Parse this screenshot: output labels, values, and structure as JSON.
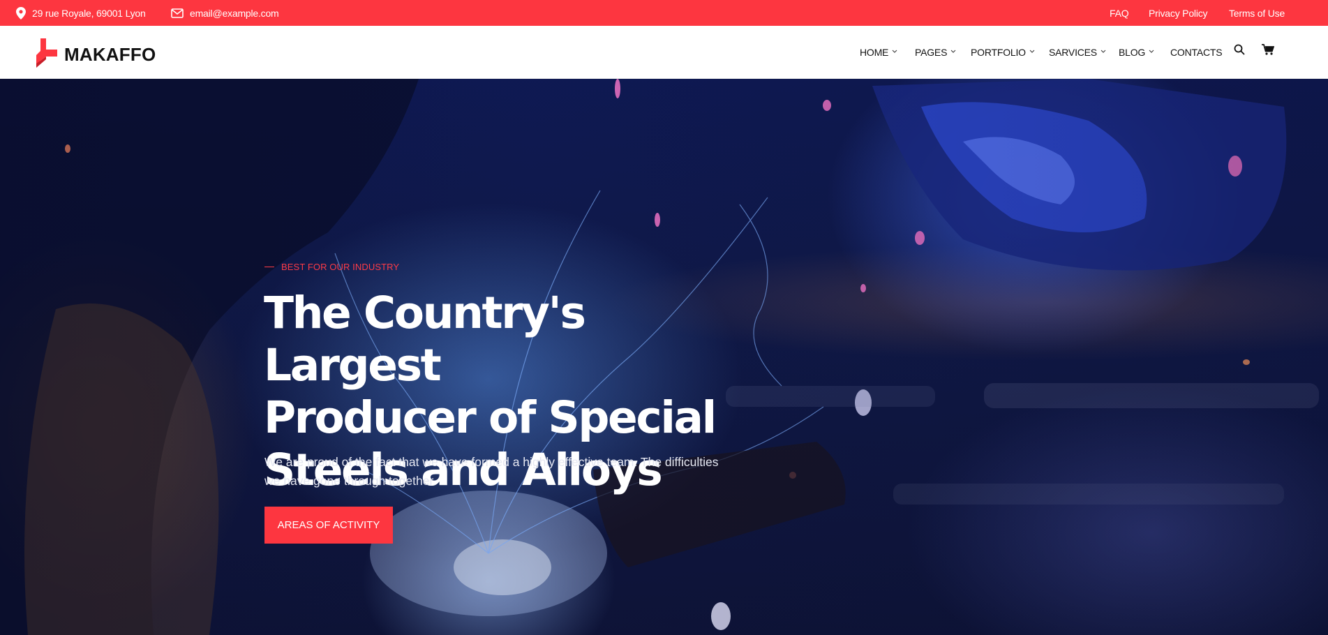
{
  "topbar": {
    "address": "29 rue Royale, 69001 Lyon",
    "email": "email@example.com",
    "links": [
      "FAQ",
      "Privacy Policy",
      "Terms of Use"
    ]
  },
  "brand": {
    "name": "MAKAFFO",
    "accent": "#fd3640"
  },
  "nav": {
    "items": [
      {
        "label": "HOME",
        "has_dropdown": true
      },
      {
        "label": "PAGES",
        "has_dropdown": true
      },
      {
        "label": "PORTFOLIO",
        "has_dropdown": true
      },
      {
        "label": "SARVICES",
        "has_dropdown": true
      },
      {
        "label": "BLOG",
        "has_dropdown": true
      },
      {
        "label": "CONTACTS",
        "has_dropdown": false
      }
    ],
    "icons": [
      "search-icon",
      "cart-icon"
    ]
  },
  "hero": {
    "kicker": "BEST FOR OUR INDUSTRY",
    "headline_lines": [
      "The Country's Largest",
      "Producer of Special",
      "Steels and Alloys"
    ],
    "subtitle_lines": [
      "We are proud of the fact that we have formed a highly effective team. The difficulties",
      "we have gone through together"
    ],
    "cta_label": "AREAS OF ACTIVITY"
  }
}
